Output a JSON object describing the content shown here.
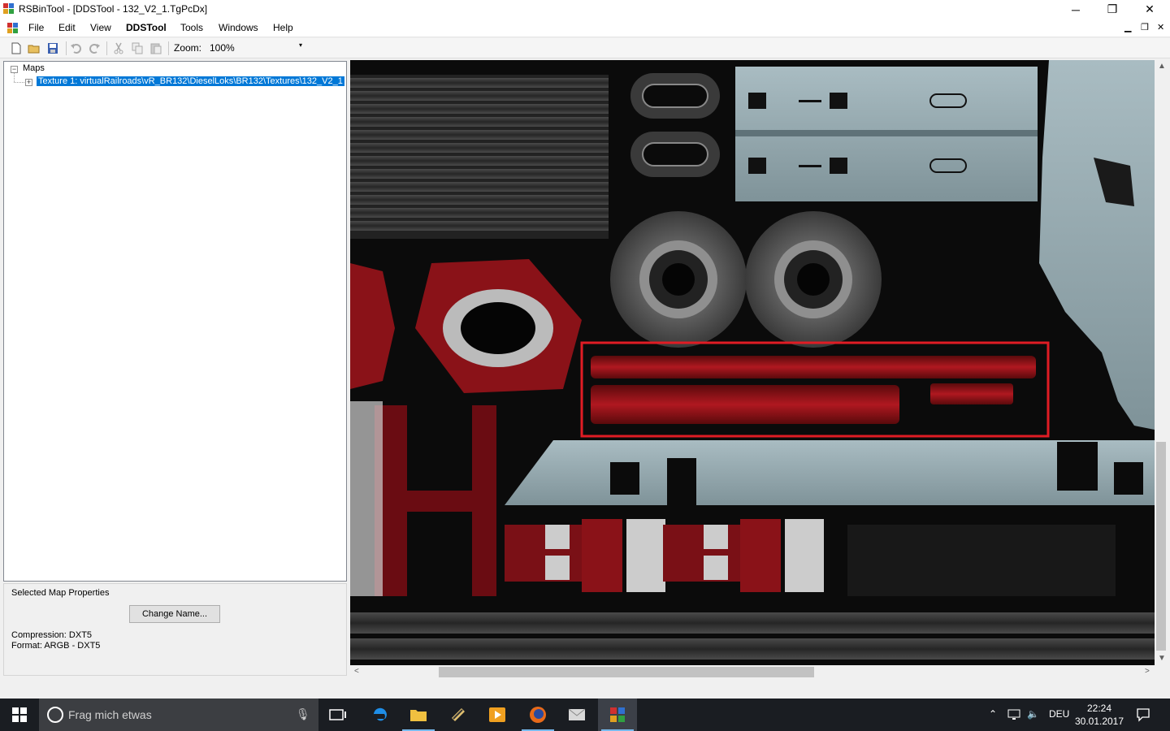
{
  "window": {
    "title": "RSBinTool - [DDSTool - 132_V2_1.TgPcDx]",
    "minimize_glyph": "─",
    "maximize_glyph": "❐",
    "close_glyph": "✕"
  },
  "menubar": {
    "items": [
      "File",
      "Edit",
      "View",
      "DDSTool",
      "Tools",
      "Windows",
      "Help"
    ],
    "mdi_minimize": "▁",
    "mdi_restore": "❐",
    "mdi_close": "✕"
  },
  "toolbar": {
    "icons": [
      "new-file-icon",
      "open-folder-icon",
      "save-icon",
      "undo-icon",
      "redo-icon",
      "cut-icon",
      "copy-icon",
      "paste-icon"
    ],
    "zoom_label": "Zoom:",
    "zoom_value": "100%",
    "dropdown_glyph": "▾"
  },
  "tree": {
    "root": {
      "label": "Maps",
      "expander": "−"
    },
    "children": [
      {
        "label": "Texture 1: virtualRailroads\\vR_BR132\\DieselLoks\\BR132\\Textures\\132_V2_1",
        "expander": "+",
        "selected": true
      }
    ]
  },
  "properties": {
    "legend": "Selected Map Properties",
    "change_name_button": "Change Name...",
    "compression": "Compression: DXT5",
    "format": "Format: ARGB - DXT5"
  },
  "scrollbars": {
    "up": "▲",
    "down": "▼",
    "left": "<",
    "right": ">"
  },
  "highlight_color": "#e01c24",
  "taskbar": {
    "search_placeholder": "Frag mich etwas",
    "apps": [
      "task-view-icon",
      "edge-icon",
      "file-explorer-icon",
      "app-icon",
      "media-player-icon",
      "firefox-icon",
      "mail-icon",
      "rsbintool-icon"
    ],
    "language": "DEU",
    "time": "22:24",
    "date": "30.01.2017"
  }
}
